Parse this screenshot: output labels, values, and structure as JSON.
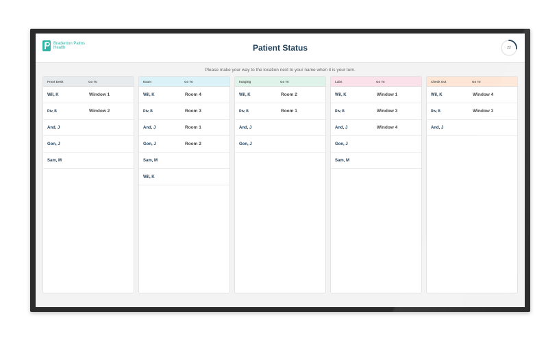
{
  "brand": {
    "line1": "Bradenton Palms",
    "line2": "Health",
    "accent_color": "#32b5a6",
    "logo_icon": "bp-logo-icon"
  },
  "header": {
    "title": "Patient Status",
    "timer_value": "22",
    "timer_progress": 0.27
  },
  "instruction": "Please make your way to the location next to your name when it is your turn.",
  "columns": [
    {
      "title": "Front Desk",
      "goto": "Go To",
      "color": "#e8ebee",
      "rows": [
        {
          "name": "Wil, K",
          "dest": "Window 1"
        },
        {
          "name": "Riv, B",
          "dest": "Window 2"
        },
        {
          "name": "And, J",
          "dest": ""
        },
        {
          "name": "Gon, J",
          "dest": ""
        },
        {
          "name": "Sam, M",
          "dest": ""
        }
      ]
    },
    {
      "title": "Exam",
      "goto": "Go To",
      "color": "#dbf3f8",
      "rows": [
        {
          "name": "Wil, K",
          "dest": "Room 4"
        },
        {
          "name": "Riv, B",
          "dest": "Room 3"
        },
        {
          "name": "And, J",
          "dest": "Room 1"
        },
        {
          "name": "Gon, J",
          "dest": "Room 2"
        },
        {
          "name": "Sam, M",
          "dest": ""
        },
        {
          "name": "Wil, K",
          "dest": ""
        }
      ]
    },
    {
      "title": "Imaging",
      "goto": "Go To",
      "color": "#dff3ea",
      "rows": [
        {
          "name": "Wil, K",
          "dest": "Room 2"
        },
        {
          "name": "Riv, B",
          "dest": "Room 1"
        },
        {
          "name": "And, J",
          "dest": ""
        },
        {
          "name": "Gon, J",
          "dest": ""
        }
      ]
    },
    {
      "title": "Labs",
      "goto": "Go To",
      "color": "#fbe2ea",
      "rows": [
        {
          "name": "Wil, K",
          "dest": "Window 1"
        },
        {
          "name": "Riv, B",
          "dest": "Window 3"
        },
        {
          "name": "And, J",
          "dest": "Window 4"
        },
        {
          "name": "Gon, J",
          "dest": ""
        },
        {
          "name": "Sam, M",
          "dest": ""
        }
      ]
    },
    {
      "title": "Check Out",
      "goto": "Go To",
      "color": "#fde6d6",
      "rows": [
        {
          "name": "Wil, K",
          "dest": "Window 4"
        },
        {
          "name": "Riv, B",
          "dest": "Window 3"
        },
        {
          "name": "And, J",
          "dest": ""
        }
      ]
    }
  ]
}
